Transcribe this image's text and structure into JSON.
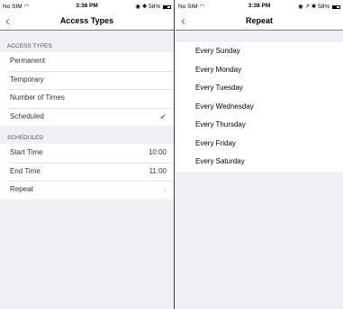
{
  "left": {
    "status": {
      "carrier": "No SIM",
      "time": "3:38 PM",
      "battery": "58%"
    },
    "nav": {
      "back_icon": "chevron-left-icon",
      "title": "Access Types"
    },
    "access_types": {
      "header": "ACCESS TYPES",
      "items": [
        {
          "label": "Permanent",
          "selected": false
        },
        {
          "label": "Temporary",
          "selected": false
        },
        {
          "label": "Number of Times",
          "selected": false
        },
        {
          "label": "Scheduled",
          "selected": true
        }
      ]
    },
    "scheduled": {
      "header": "SCHEDULED",
      "start_label": "Start Time",
      "start_value": "10:00",
      "end_label": "End Time",
      "end_value": "11:00",
      "repeat_label": "Repeat"
    }
  },
  "right": {
    "status": {
      "carrier": "No SIM",
      "time": "3:38 PM",
      "battery": "58%"
    },
    "nav": {
      "back_icon": "chevron-left-icon",
      "title": "Repeat"
    },
    "days": [
      "Every Sunday",
      "Every Monday",
      "Every Tuesday",
      "Every Wednesday",
      "Every Thursday",
      "Every Friday",
      "Every Saturday"
    ]
  },
  "colors": {
    "accent": "#2ea84a",
    "background": "#efeff4"
  }
}
